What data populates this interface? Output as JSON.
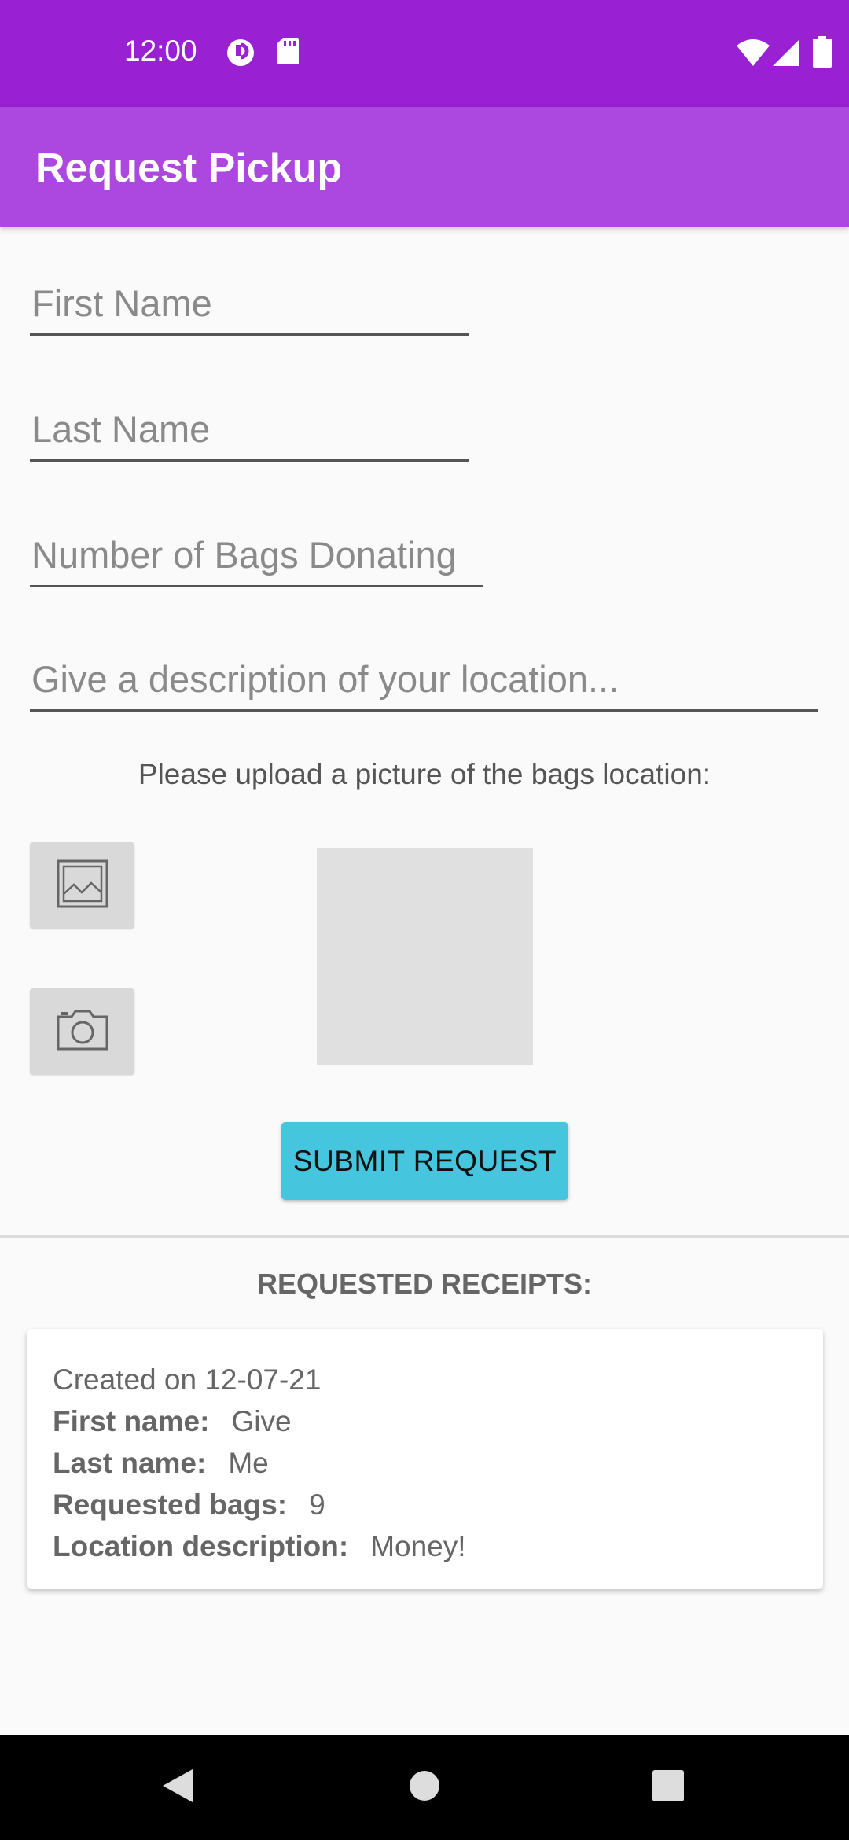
{
  "status_bar": {
    "time": "12:00",
    "left_icons": [
      "data-saver-icon",
      "sd-card-icon"
    ],
    "right_icons": [
      "wifi-icon",
      "cell-signal-icon",
      "battery-icon"
    ]
  },
  "app_bar": {
    "title": "Request Pickup"
  },
  "form": {
    "first_name": {
      "placeholder": "First Name",
      "value": ""
    },
    "last_name": {
      "placeholder": "Last Name",
      "value": ""
    },
    "bags": {
      "placeholder": "Number of Bags Donating",
      "value": ""
    },
    "location": {
      "placeholder": "Give a description of your location...",
      "value": ""
    },
    "upload_prompt": "Please upload a picture of the bags location:",
    "gallery_icon": "image-icon",
    "camera_icon": "camera-icon",
    "submit_label": "SUBMIT REQUEST"
  },
  "receipts": {
    "heading": "REQUESTED RECEIPTS:",
    "items": [
      {
        "created": "Created on 12-07-21",
        "first_name_label": "First name:",
        "first_name": "Give",
        "last_name_label": "Last name:",
        "last_name": "Me",
        "bags_label": "Requested bags:",
        "bags": "9",
        "location_label": "Location description:",
        "location": "Money!"
      }
    ]
  },
  "nav_bar": {
    "icons": [
      "back-icon",
      "home-icon",
      "recents-icon"
    ]
  },
  "colors": {
    "status_bar": "#9920d3",
    "app_bar": "#ac47e0",
    "submit_button": "#45c5de"
  }
}
